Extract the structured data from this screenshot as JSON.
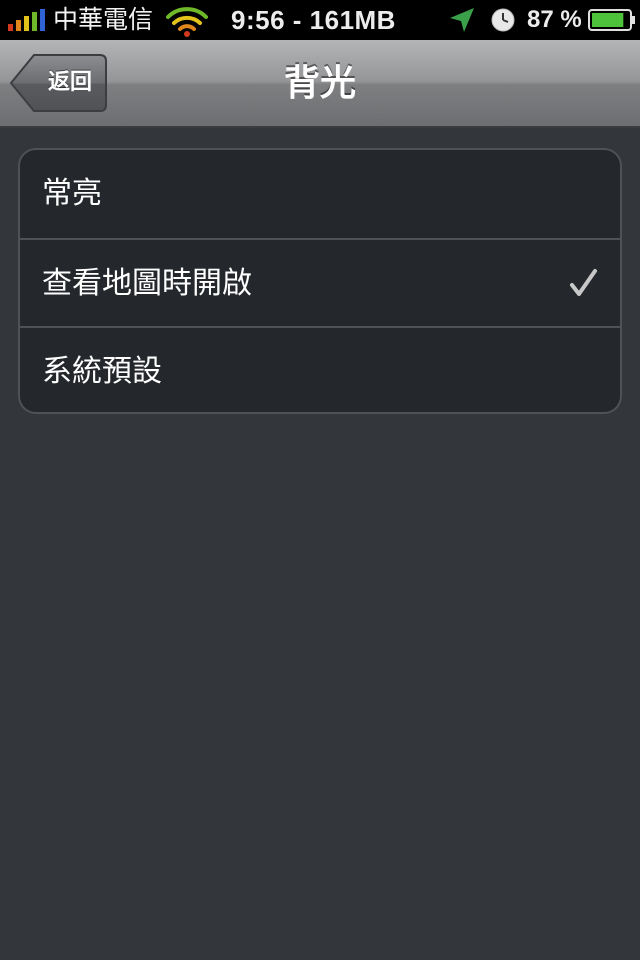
{
  "status_bar": {
    "carrier": "中華電信",
    "time": "9:56 - 161MB",
    "battery_percent": "87 %",
    "battery_level": 0.87,
    "icons": [
      "signal-icon",
      "wifi-icon",
      "location-arrow-icon",
      "alarm-clock-icon",
      "battery-icon"
    ]
  },
  "nav": {
    "title": "背光",
    "back_label": "返回"
  },
  "options": [
    {
      "label": "常亮",
      "selected": false
    },
    {
      "label": "查看地圖時開啟",
      "selected": true
    },
    {
      "label": "系統預設",
      "selected": false
    }
  ],
  "colors": {
    "background": "#33363b",
    "group_background": "#24272c",
    "group_border": "#4e5156",
    "checkmark": "#c8c8c8"
  }
}
